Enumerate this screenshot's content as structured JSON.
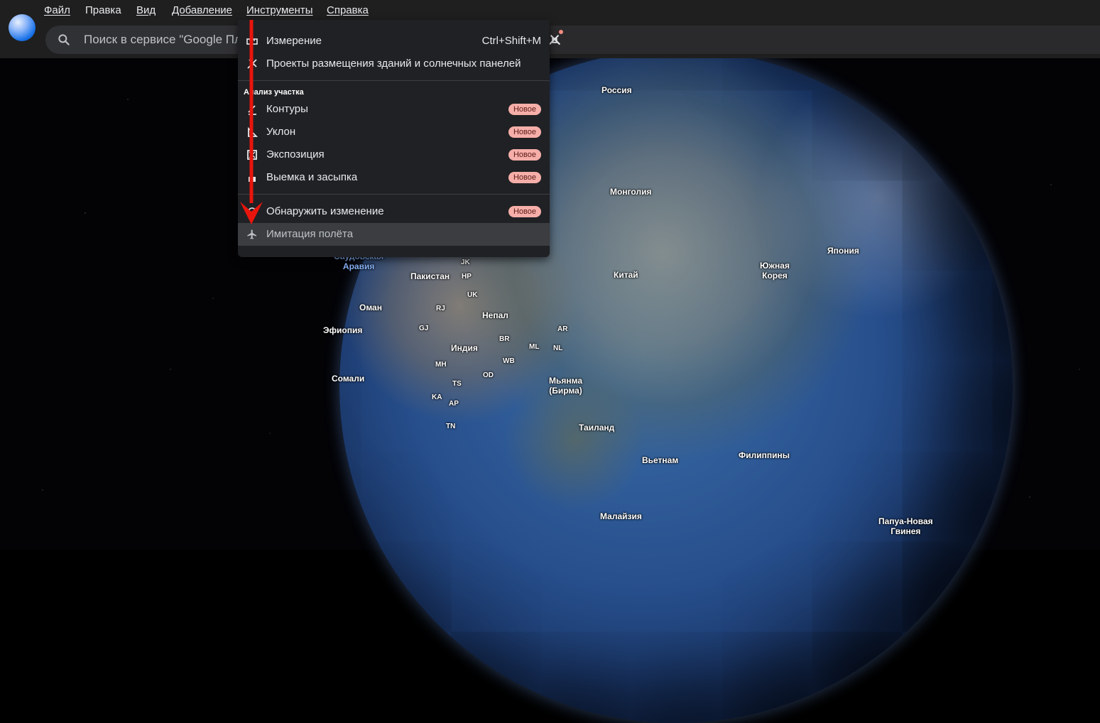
{
  "menubar": {
    "items": [
      "Файл",
      "Правка",
      "Вид",
      "Добавление",
      "Инструменты",
      "Справка"
    ]
  },
  "search": {
    "placeholder": "Поиск в сервисе \"Google Планета Земля\""
  },
  "tools_menu": {
    "measure": {
      "label": "Измерение",
      "shortcut": "Ctrl+Shift+M",
      "icon": "ruler-icon"
    },
    "projects": {
      "label": "Проекты размещения зданий и солнечных панелей",
      "icon": "solar-panel-icon"
    },
    "section_title": "Анализ участка",
    "analysis_items": [
      {
        "label": "Контуры",
        "badge": "Новое",
        "icon": "contour-icon"
      },
      {
        "label": "Уклон",
        "badge": "Новое",
        "icon": "slope-icon"
      },
      {
        "label": "Экспозиция",
        "badge": "Новое",
        "icon": "aspect-icon"
      },
      {
        "label": "Выемка и засыпка",
        "badge": "Новое",
        "icon": "cut-fill-icon"
      }
    ],
    "detect_change": {
      "label": "Обнаружить изменение",
      "badge": "Новое",
      "icon": "detect-change-icon"
    },
    "flight_sim": {
      "label": "Имитация полёта",
      "icon": "airplane-icon"
    }
  },
  "map_labels": [
    {
      "text": "Россия"
    },
    {
      "text": "Монголия"
    },
    {
      "text": "Китай"
    },
    {
      "text": "Япония"
    },
    {
      "text": "Южная\nКорея"
    },
    {
      "text": "Пакистан"
    },
    {
      "text": "Оман"
    },
    {
      "text": "Эфиопия"
    },
    {
      "text": "Сомали"
    },
    {
      "text": "Индия"
    },
    {
      "text": "Непал"
    },
    {
      "text": "Мьянма\n(Бирма)"
    },
    {
      "text": "Таиланд"
    },
    {
      "text": "Вьетнам"
    },
    {
      "text": "Филиппины"
    },
    {
      "text": "Малайзия"
    },
    {
      "text": "Папуа-Новая\nГвинея"
    },
    {
      "text": "Саудовская\nАравия"
    },
    {
      "text": "JK"
    },
    {
      "text": "HP"
    },
    {
      "text": "UK"
    },
    {
      "text": "RJ"
    },
    {
      "text": "GJ"
    },
    {
      "text": "BR"
    },
    {
      "text": "WB"
    },
    {
      "text": "MH"
    },
    {
      "text": "OD"
    },
    {
      "text": "TS"
    },
    {
      "text": "KA"
    },
    {
      "text": "AP"
    },
    {
      "text": "TN"
    },
    {
      "text": "ML"
    },
    {
      "text": "NL"
    },
    {
      "text": "AR"
    }
  ],
  "colors": {
    "accent": "#8ab4f8",
    "badge_bg": "#f6aea9",
    "arrow": "#e8150c"
  }
}
